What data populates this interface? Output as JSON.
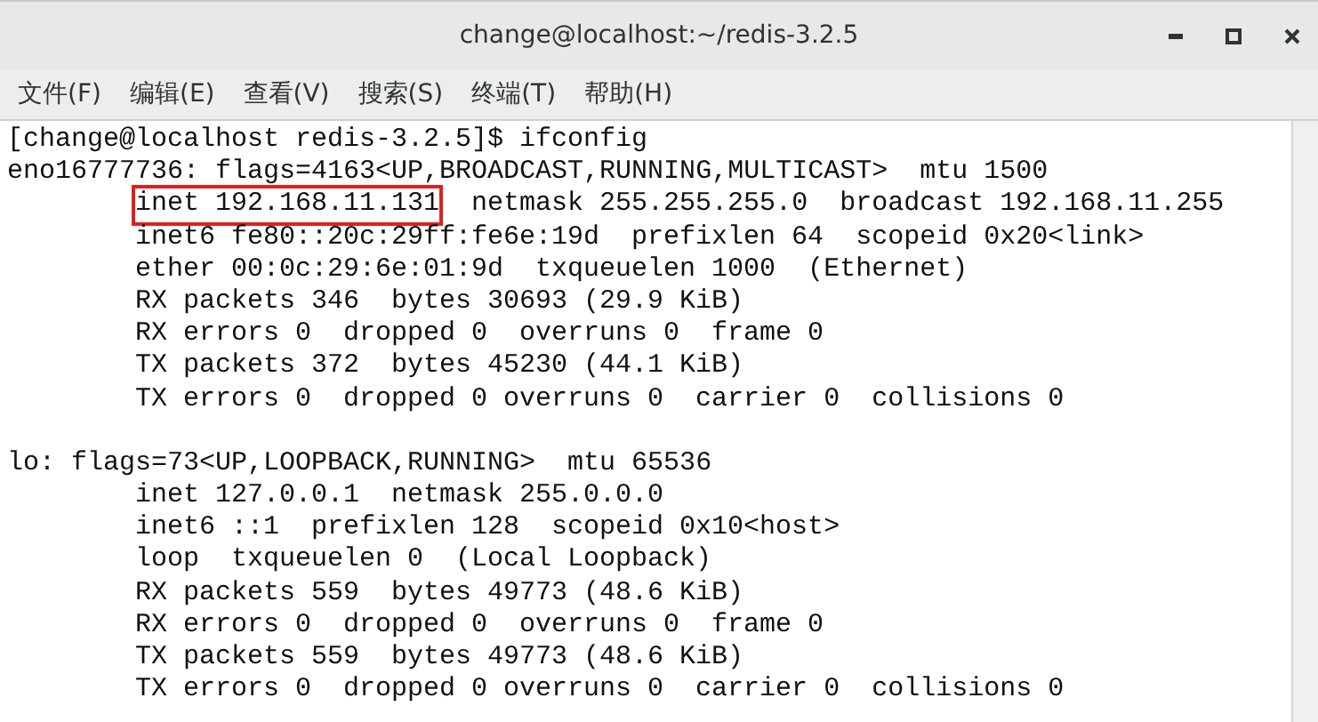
{
  "window": {
    "title": "change@localhost:~/redis-3.2.5"
  },
  "menu": [
    "文件(F)",
    "编辑(E)",
    "查看(V)",
    "搜索(S)",
    "终端(T)",
    "帮助(H)"
  ],
  "terminal": {
    "prompt": "[change@localhost redis-3.2.5]$ ifconfig",
    "interfaces": [
      {
        "header": "eno16777736: flags=4163<UP,BROADCAST,RUNNING,MULTICAST>  mtu 1500",
        "lines": [
          [
            {
              "text": "inet 192.168.11.131",
              "highlighted": true
            },
            {
              "text": "  netmask 255.255.255.0  broadcast 192.168.11.255",
              "highlighted": false
            }
          ],
          [
            {
              "text": "inet6 fe80::20c:29ff:fe6e:19d  prefixlen 64  scopeid 0x20<link>",
              "highlighted": false
            }
          ],
          [
            {
              "text": "ether 00:0c:29:6e:01:9d  txqueuelen 1000  (Ethernet)",
              "highlighted": false
            }
          ],
          [
            {
              "text": "RX packets 346  bytes 30693 (29.9 KiB)",
              "highlighted": false
            }
          ],
          [
            {
              "text": "RX errors 0  dropped 0  overruns 0  frame 0",
              "highlighted": false
            }
          ],
          [
            {
              "text": "TX packets 372  bytes 45230 (44.1 KiB)",
              "highlighted": false
            }
          ],
          [
            {
              "text": "TX errors 0  dropped 0 overruns 0  carrier 0  collisions 0",
              "highlighted": false
            }
          ]
        ]
      },
      {
        "header": "lo: flags=73<UP,LOOPBACK,RUNNING>  mtu 65536",
        "lines": [
          [
            {
              "text": "inet 127.0.0.1  netmask 255.0.0.0",
              "highlighted": false
            }
          ],
          [
            {
              "text": "inet6 ::1  prefixlen 128  scopeid 0x10<host>",
              "highlighted": false
            }
          ],
          [
            {
              "text": "loop  txqueuelen 0  (Local Loopback)",
              "highlighted": false
            }
          ],
          [
            {
              "text": "RX packets 559  bytes 49773 (48.6 KiB)",
              "highlighted": false
            }
          ],
          [
            {
              "text": "RX errors 0  dropped 0  overruns 0  frame 0",
              "highlighted": false
            }
          ],
          [
            {
              "text": "TX packets 559  bytes 49773 (48.6 KiB)",
              "highlighted": false
            }
          ],
          [
            {
              "text": "TX errors 0  dropped 0 overruns 0  carrier 0  collisions 0",
              "highlighted": false
            }
          ]
        ]
      }
    ]
  }
}
